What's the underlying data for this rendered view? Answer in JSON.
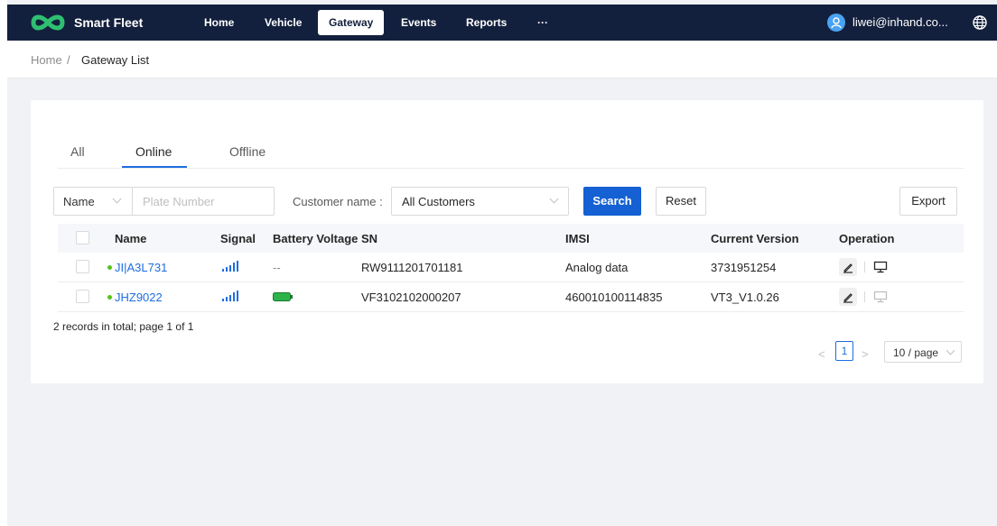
{
  "header": {
    "brand": "Smart Fleet",
    "nav": [
      "Home",
      "Vehicle",
      "Gateway",
      "Events",
      "Reports",
      "···"
    ],
    "active_nav": "Gateway",
    "user": "liwei@inhand.co...",
    "logo_color": "#2fbf71",
    "bar_color": "#13203d"
  },
  "breadcrumb": {
    "home": "Home",
    "separator": "/",
    "current": "Gateway List"
  },
  "tabs": {
    "items": [
      "All",
      "Online",
      "Offline"
    ],
    "active": "Online"
  },
  "filters": {
    "field_select": "Name",
    "plate_placeholder": "Plate Number",
    "customer_label": "Customer name :",
    "customer_value": "All Customers",
    "search": "Search",
    "reset": "Reset",
    "export": "Export"
  },
  "table": {
    "columns": [
      "Name",
      "Signal",
      "Battery Voltage",
      "SN",
      "IMSI",
      "Current Version",
      "Operation"
    ],
    "rows": [
      {
        "name": "JI|A3L731",
        "signal": "signal-bars-icon",
        "battery": "--",
        "sn": "RW9111201701181",
        "imsi": "Analog data",
        "version": "3731951254",
        "status": "online"
      },
      {
        "name": "JHZ9022",
        "signal": "signal-bars-icon",
        "battery": "battery-full-icon",
        "sn": "VF3102102000207",
        "imsi": "460010100114835",
        "version": "VT3_V1.0.26",
        "status": "online"
      }
    ]
  },
  "pagination": {
    "summary": "2 records in total; page 1 of 1",
    "current": "1",
    "page_size": "10 / page",
    "prev": "<",
    "next": ">"
  },
  "colors": {
    "accent": "#1560d2",
    "online": "#52c41a",
    "battery": "#2db34a",
    "signal": "#1f6ee0"
  }
}
